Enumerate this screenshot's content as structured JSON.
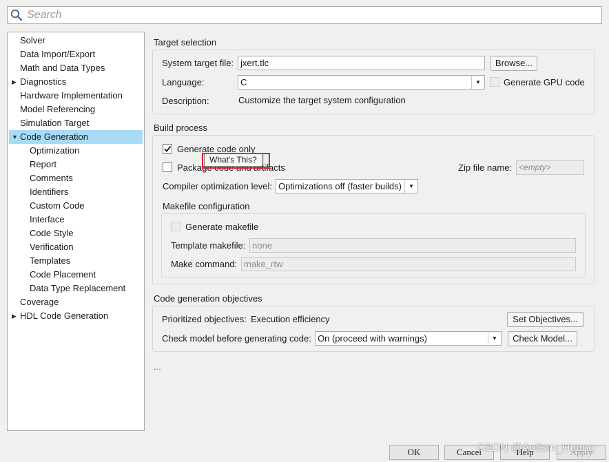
{
  "search": {
    "placeholder": "Search",
    "icon": "search-icon"
  },
  "tree": {
    "items": [
      {
        "label": "Solver",
        "level": 0
      },
      {
        "label": "Data Import/Export",
        "level": 0
      },
      {
        "label": "Math and Data Types",
        "level": 0
      },
      {
        "label": "Diagnostics",
        "level": 0,
        "arrow": "▶"
      },
      {
        "label": "Hardware Implementation",
        "level": 0
      },
      {
        "label": "Model Referencing",
        "level": 0
      },
      {
        "label": "Simulation Target",
        "level": 0
      },
      {
        "label": "Code Generation",
        "level": 0,
        "arrow": "▼",
        "selected": true
      },
      {
        "label": "Optimization",
        "level": 1
      },
      {
        "label": "Report",
        "level": 1
      },
      {
        "label": "Comments",
        "level": 1
      },
      {
        "label": "Identifiers",
        "level": 1
      },
      {
        "label": "Custom Code",
        "level": 1
      },
      {
        "label": "Interface",
        "level": 1
      },
      {
        "label": "Code Style",
        "level": 1
      },
      {
        "label": "Verification",
        "level": 1
      },
      {
        "label": "Templates",
        "level": 1
      },
      {
        "label": "Code Placement",
        "level": 1
      },
      {
        "label": "Data Type Replacement",
        "level": 1
      },
      {
        "label": "Coverage",
        "level": 0
      },
      {
        "label": "HDL Code Generation",
        "level": 0,
        "arrow": "▶"
      }
    ],
    "selected_color": "#a7dbf7"
  },
  "target": {
    "title": "Target selection",
    "system_target_label": "System target file:",
    "system_target_value": "jxert.tlc",
    "browse_label": "Browse...",
    "language_label": "Language:",
    "language_value": "C",
    "gpu_label": "Generate GPU code",
    "description_label": "Description:",
    "description_value": "Customize the target system configuration"
  },
  "build": {
    "title": "Build process",
    "generate_code_only_label": "Generate code only",
    "package_label": "Package code and artifacts",
    "zip_label": "Zip file name:",
    "zip_placeholder": "<empty>",
    "compiler_label": "Compiler optimization level:",
    "compiler_value": "Optimizations off (faster builds)",
    "makefile_title": "Makefile configuration",
    "generate_makefile_label": "Generate makefile",
    "template_makefile_label": "Template makefile:",
    "template_makefile_value": "none",
    "make_command_label": "Make command:",
    "make_command_value": "make_rtw"
  },
  "tooltip": {
    "text": "What's This?",
    "highlight_color": "#e0202a"
  },
  "objectives": {
    "title": "Code generation objectives",
    "prioritized_label": "Prioritized objectives:",
    "prioritized_value": "Execution efficiency",
    "set_objectives_label": "Set Objectives...",
    "check_model_label": "Check model before generating code:",
    "check_model_value": "On (proceed with warnings)",
    "check_model_button": "Check Model..."
  },
  "ellipsis": "...",
  "footer": {
    "ok": "OK",
    "cancel": "Cancel",
    "help": "Help",
    "apply": "Apply",
    "watermark": "CSDN @Autism_Huang"
  }
}
